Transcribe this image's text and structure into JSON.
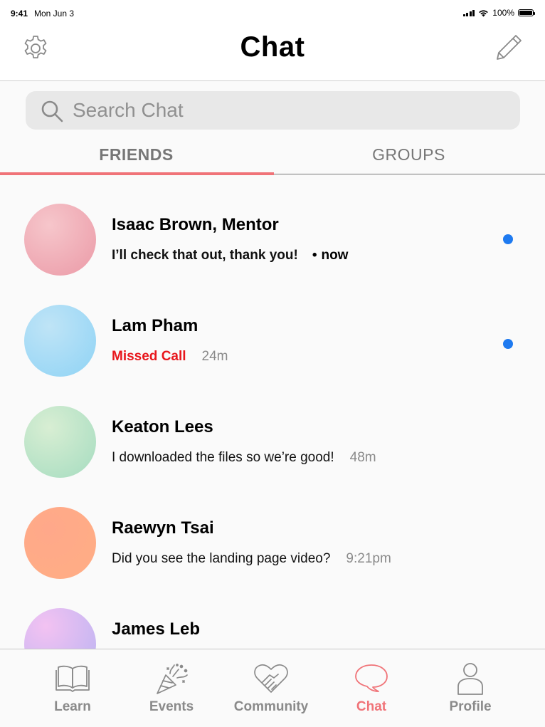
{
  "status_bar": {
    "time": "9:41",
    "date": "Mon Jun 3",
    "battery": "100%"
  },
  "header": {
    "title": "Chat",
    "settings_icon": "gear-icon",
    "compose_icon": "pencil-icon"
  },
  "search": {
    "placeholder": "Search Chat",
    "value": ""
  },
  "tabs": [
    {
      "label": "FRIENDS",
      "active": true
    },
    {
      "label": "GROUPS",
      "active": false
    }
  ],
  "chats": [
    {
      "name": "Isaac Brown, Mentor",
      "message": "I’ll check that out, thank you!",
      "separator": "•",
      "time": "now",
      "unread": true,
      "avatar_color": "#f1a3ad"
    },
    {
      "name": "Lam Pham",
      "message": "Missed Call",
      "time": "24m",
      "unread": true,
      "avatar_color": "#9fd8f4"
    },
    {
      "name": "Keaton Lees",
      "message": "I downloaded the files so we’re good!",
      "time": "48m",
      "unread": false,
      "avatar_color": "#b2e2c2"
    },
    {
      "name": "Raewyn Tsai",
      "message": "Did you see the landing page video?",
      "time": "9:21pm",
      "unread": false,
      "avatar_color": "#ffab87"
    },
    {
      "name": "James Leb",
      "message": "",
      "time": "",
      "unread": false,
      "avatar_color": "#d6b7f5"
    }
  ],
  "tab_bar": [
    {
      "label": "Learn",
      "icon": "book-icon",
      "active": false
    },
    {
      "label": "Events",
      "icon": "party-popper-icon",
      "active": false
    },
    {
      "label": "Community",
      "icon": "handshake-heart-icon",
      "active": false
    },
    {
      "label": "Chat",
      "icon": "speech-bubble-icon",
      "active": true
    },
    {
      "label": "Profile",
      "icon": "person-icon",
      "active": false
    }
  ],
  "colors": {
    "accent": "#f07378",
    "unread_dot": "#1e7af0",
    "missed_call": "#e8161c"
  }
}
